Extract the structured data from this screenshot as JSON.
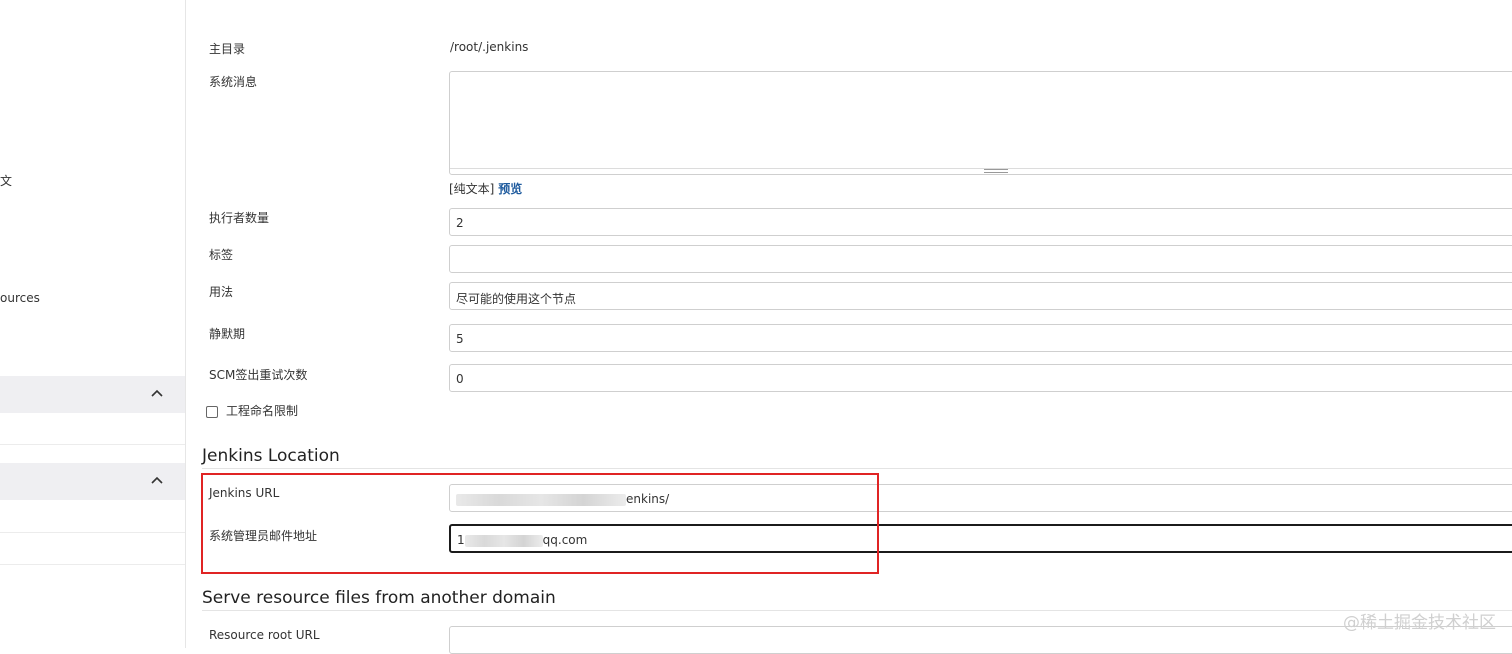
{
  "sidebar": {
    "fragment_text": "文",
    "resources_text": "ources",
    "panels": [
      {
        "icon": "chevron-up-icon"
      },
      {
        "icon": "chevron-up-icon"
      }
    ]
  },
  "form": {
    "home_dir_label": "主目录",
    "home_dir_value": "/root/.jenkins",
    "system_message_label": "系统消息",
    "editor_plain_text": "[纯文本]",
    "editor_preview": "预览",
    "executors_label": "执行者数量",
    "executors_value": "2",
    "labels_label": "标签",
    "labels_value": "",
    "usage_label": "用法",
    "usage_value": "尽可能的使用这个节点",
    "quiet_period_label": "静默期",
    "quiet_period_value": "5",
    "scm_retry_label": "SCM签出重试次数",
    "scm_retry_value": "0",
    "project_naming_label": "工程命名限制"
  },
  "jenkins_location": {
    "title": "Jenkins Location",
    "url_label": "Jenkins URL",
    "url_value_suffix": "enkins/",
    "admin_email_label": "系统管理员邮件地址",
    "admin_email_prefix": "1",
    "admin_email_suffix": "qq.com"
  },
  "resource_domain": {
    "title": "Serve resource files from another domain",
    "root_url_label": "Resource root URL",
    "root_url_value": ""
  },
  "watermark": "@稀土掘金技术社区",
  "colors": {
    "highlight_box": "#e02424",
    "link": "#1f5b9e",
    "panel_bg": "#efeff2"
  }
}
